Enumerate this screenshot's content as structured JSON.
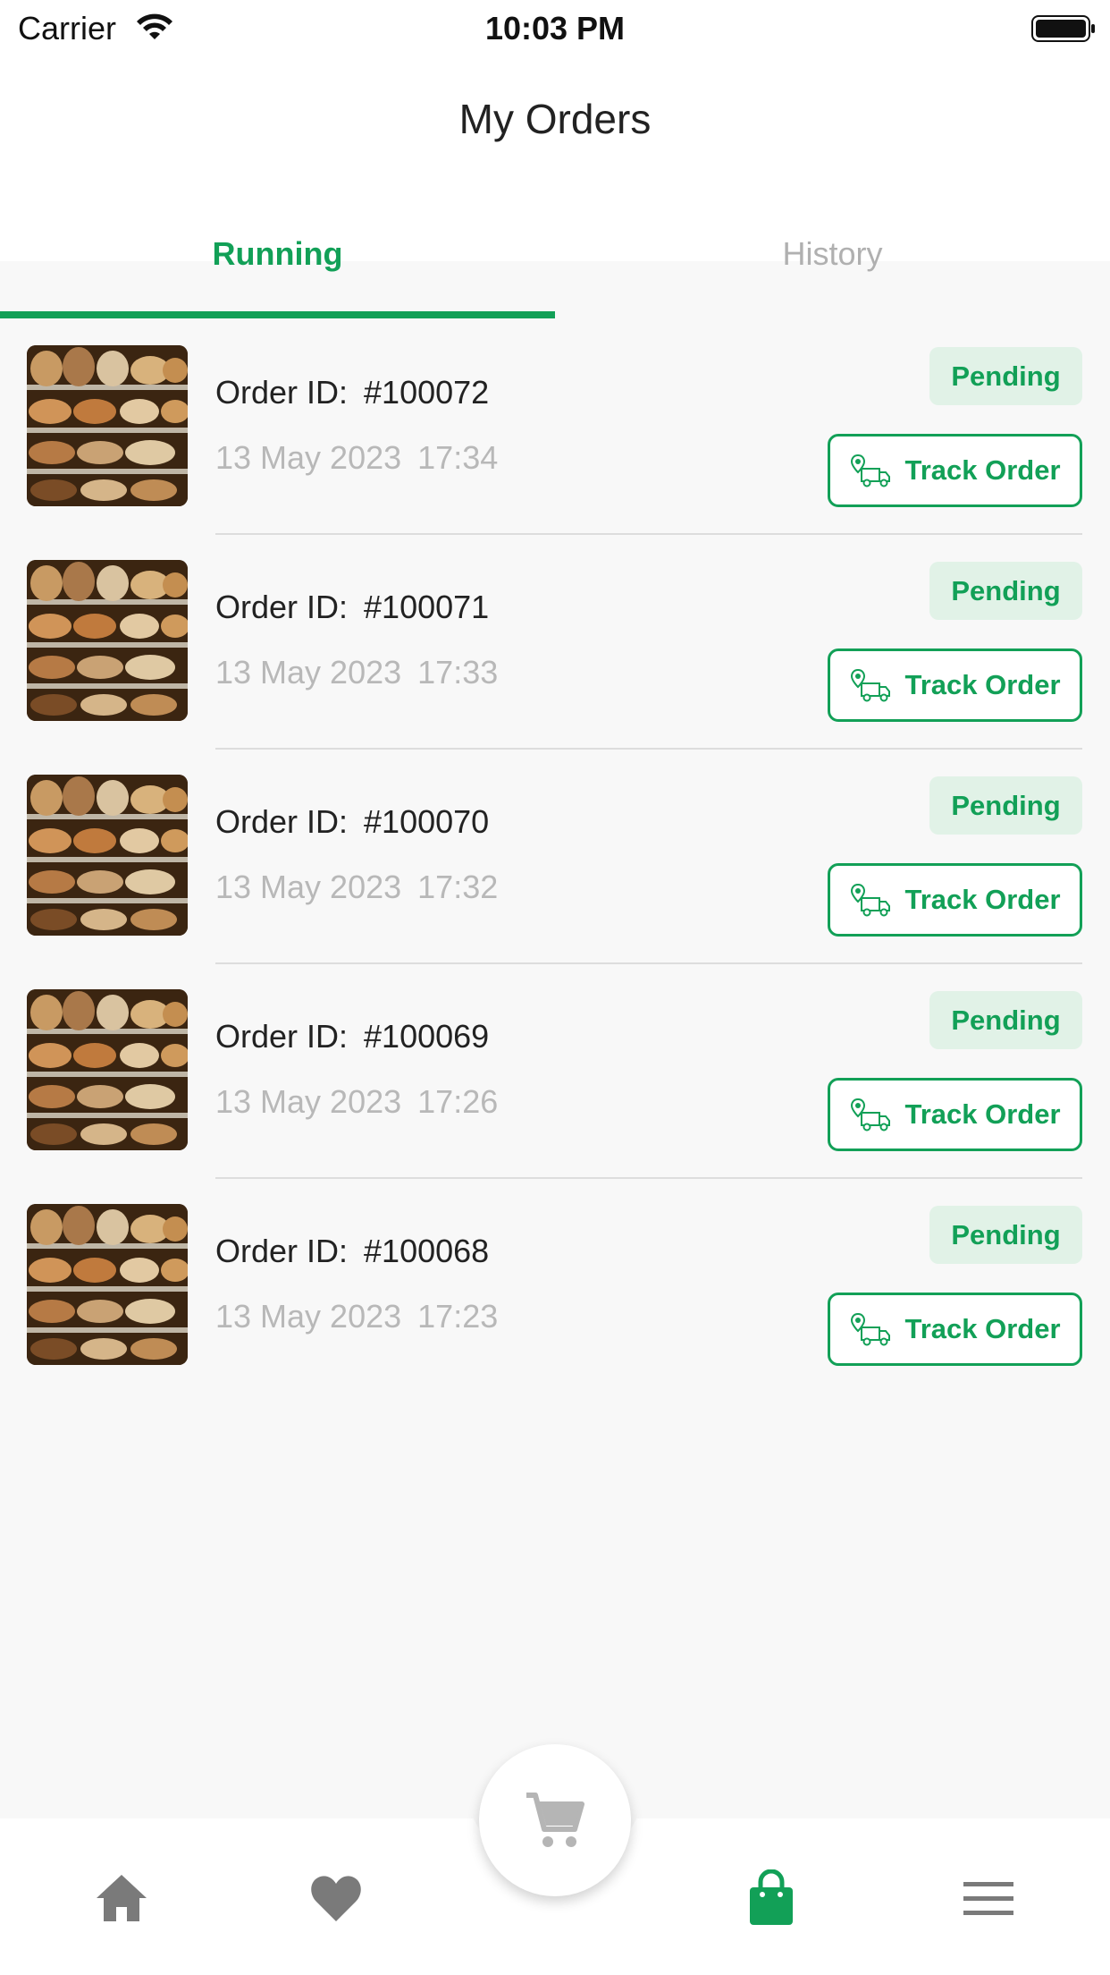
{
  "status_bar": {
    "carrier": "Carrier",
    "time": "10:03 PM"
  },
  "header": {
    "title": "My Orders"
  },
  "tabs": [
    {
      "label": "Running",
      "active": true
    },
    {
      "label": "History",
      "active": false
    }
  ],
  "orders": [
    {
      "id_label": "Order ID:",
      "id": "#100072",
      "date": "13 May 2023",
      "time": "17:34",
      "status": "Pending",
      "action": "Track Order"
    },
    {
      "id_label": "Order ID:",
      "id": "#100071",
      "date": "13 May 2023",
      "time": "17:33",
      "status": "Pending",
      "action": "Track Order"
    },
    {
      "id_label": "Order ID:",
      "id": "#100070",
      "date": "13 May 2023",
      "time": "17:32",
      "status": "Pending",
      "action": "Track Order"
    },
    {
      "id_label": "Order ID:",
      "id": "#100069",
      "date": "13 May 2023",
      "time": "17:26",
      "status": "Pending",
      "action": "Track Order"
    },
    {
      "id_label": "Order ID:",
      "id": "#100068",
      "date": "13 May 2023",
      "time": "17:23",
      "status": "Pending",
      "action": "Track Order"
    }
  ],
  "bottom_nav": {
    "items": [
      "home-icon",
      "heart-icon",
      "cart-icon",
      "shopping-bag-icon",
      "menu-icon"
    ],
    "active": "shopping-bag-icon"
  },
  "colors": {
    "accent": "#12a057",
    "badge_bg": "#e1f2e7",
    "muted_text": "#b8b8b8",
    "inactive_icon": "#7a7a7a"
  }
}
